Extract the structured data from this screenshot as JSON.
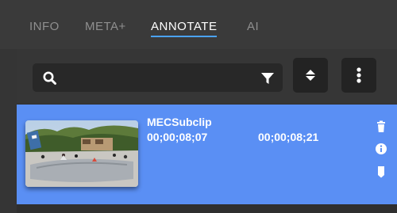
{
  "tabs": [
    {
      "label": "INFO",
      "active": false
    },
    {
      "label": "META+",
      "active": false
    },
    {
      "label": "ANNOTATE",
      "active": true
    },
    {
      "label": "AI",
      "active": false
    }
  ],
  "search": {
    "placeholder": "",
    "value": ""
  },
  "toolbar": {
    "icons": [
      "search-icon",
      "filter-icon",
      "sort-icon",
      "more-vertical-icon"
    ]
  },
  "clip": {
    "title": "MECSubclip",
    "timecode_in": "00;00;08;07",
    "timecode_out": "00;00;08;21",
    "icons": [
      "trash-icon",
      "info-icon",
      "bookmark-icon"
    ]
  },
  "colors": {
    "accent": "#4aa3ff",
    "clip_background": "#5a8ff4",
    "panel_background": "#2f2f2f"
  }
}
